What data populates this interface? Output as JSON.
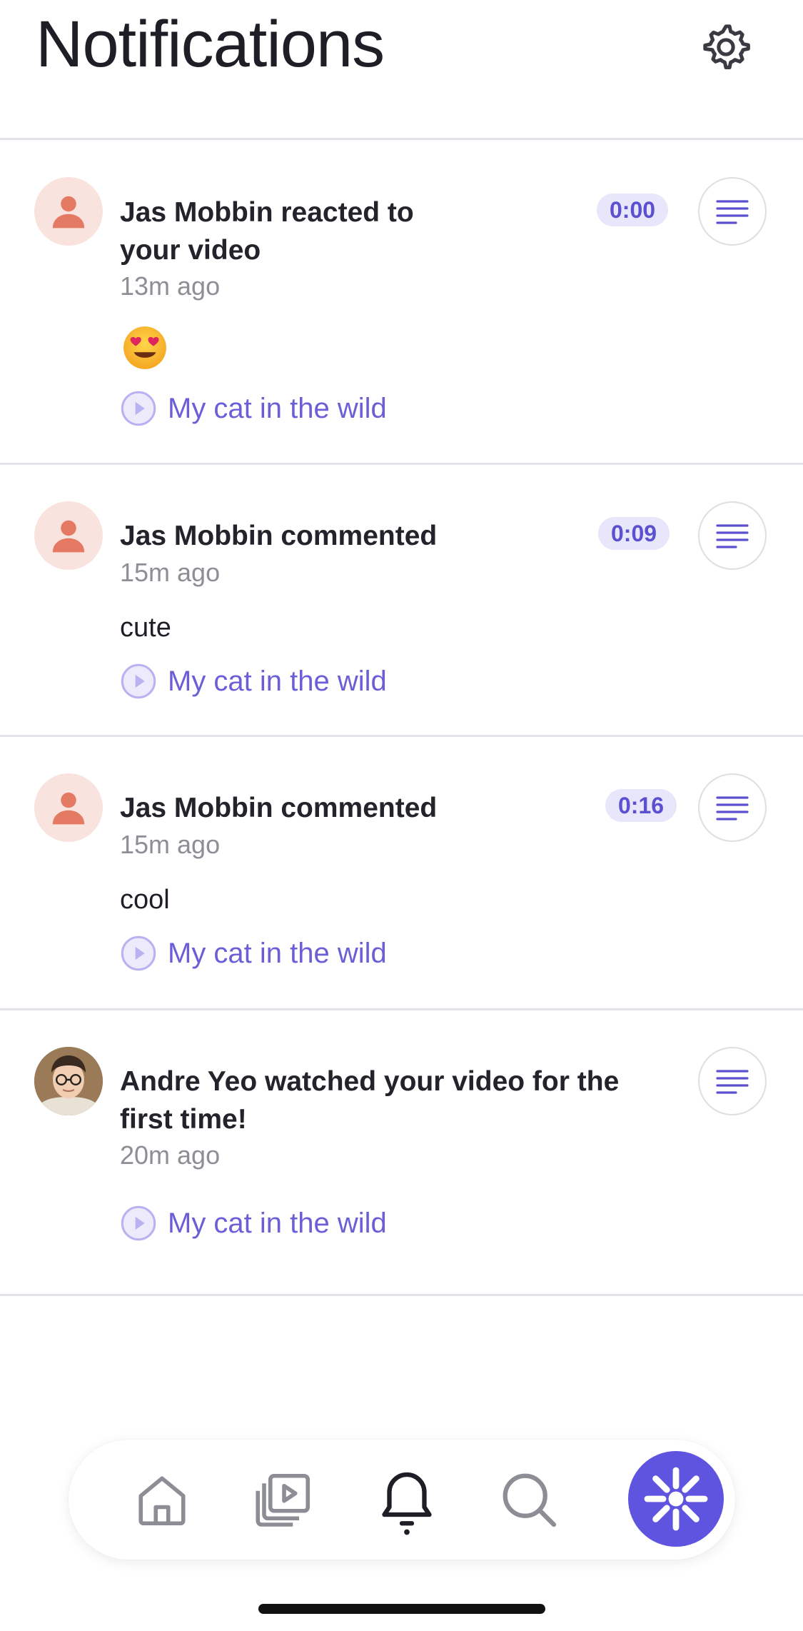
{
  "header": {
    "title": "Notifications"
  },
  "notifications": [
    {
      "actor": "Jas Mobbin",
      "title_line1": "Jas Mobbin  reacted to",
      "title_line2": "your video",
      "time": "13m ago",
      "timestamp": "0:00",
      "reaction": "heart-eyes-emoji",
      "video_title": "My cat in the wild"
    },
    {
      "actor": "Jas Mobbin",
      "title_line1": "Jas Mobbin commented",
      "time": "15m ago",
      "timestamp": "0:09",
      "comment": "cute",
      "video_title": "My cat in the wild"
    },
    {
      "actor": "Jas Mobbin",
      "title_line1": "Jas Mobbin commented",
      "time": "15m ago",
      "timestamp": "0:16",
      "comment": "cool",
      "video_title": "My cat in the wild"
    },
    {
      "actor": "Andre Yeo",
      "title_line1": "Andre Yeo watched your video for the",
      "title_line2": "first time!",
      "time": "20m ago",
      "video_title": "My cat in the wild"
    }
  ],
  "bottom_nav": {
    "items": [
      "home-icon",
      "library-icon",
      "notifications-bell-icon",
      "search-icon",
      "record-icon"
    ],
    "active": "notifications-bell-icon"
  },
  "colors": {
    "accent": "#5e54e0",
    "link": "#6a5fd6",
    "badge_bg": "#e8e6fa",
    "avatar_bg": "#f9e3df",
    "avatar_fg": "#e47a63"
  }
}
